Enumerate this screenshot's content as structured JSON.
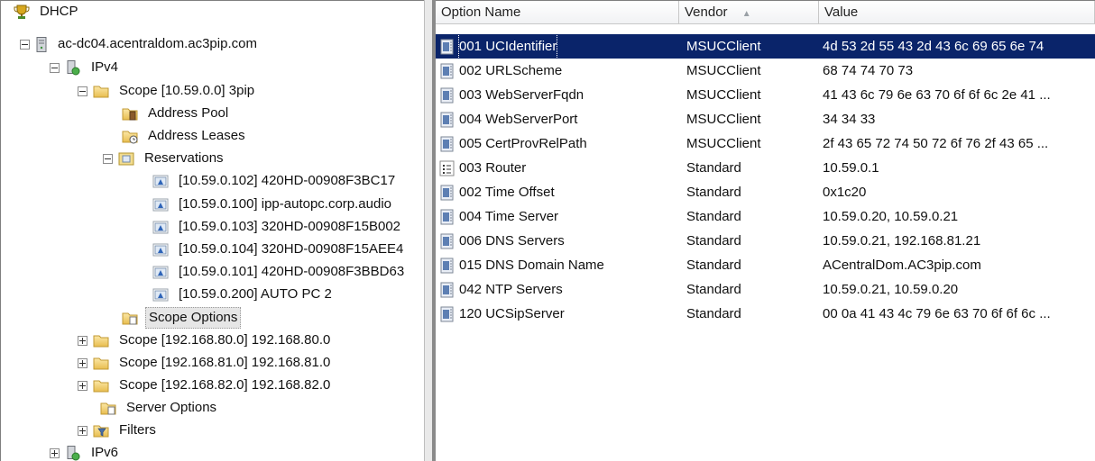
{
  "tree": {
    "root": "DHCP",
    "server": "ac-dc04.acentraldom.ac3pip.com",
    "ipv4": "IPv4",
    "scope_main": "Scope [10.59.0.0] 3pip",
    "address_pool": "Address Pool",
    "address_leases": "Address Leases",
    "reservations": "Reservations",
    "reservation_items": [
      "[10.59.0.102] 420HD-00908F3BC17",
      "[10.59.0.100] ipp-autopc.corp.audio",
      "[10.59.0.103] 320HD-00908F15B002",
      "[10.59.0.104] 320HD-00908F15AEE4",
      "[10.59.0.101] 420HD-00908F3BBD63",
      "[10.59.0.200] AUTO PC 2"
    ],
    "scope_options": "Scope Options",
    "scopes": [
      "Scope [192.168.80.0] 192.168.80.0",
      "Scope [192.168.81.0] 192.168.81.0",
      "Scope [192.168.82.0] 192.168.82.0"
    ],
    "server_options": "Server Options",
    "filters": "Filters",
    "ipv6": "IPv6"
  },
  "list": {
    "columns": {
      "name": "Option Name",
      "vendor": "Vendor",
      "value": "Value"
    },
    "sort_indicator": "▲",
    "rows": [
      {
        "name": "001 UCIdentifier",
        "vendor": "MSUCClient",
        "value": "4d 53 2d 55 43 2d 43 6c 69 65 6e 74",
        "icon": "option-binary-icon",
        "selected": true
      },
      {
        "name": "002 URLScheme",
        "vendor": "MSUCClient",
        "value": "68 74 74 70 73",
        "icon": "option-binary-icon"
      },
      {
        "name": "003 WebServerFqdn",
        "vendor": "MSUCClient",
        "value": "41 43 6c 79 6e 63 70 6f 6f 6c 2e 41 ...",
        "icon": "option-binary-icon"
      },
      {
        "name": "004 WebServerPort",
        "vendor": "MSUCClient",
        "value": "34 34 33",
        "icon": "option-binary-icon"
      },
      {
        "name": "005 CertProvRelPath",
        "vendor": "MSUCClient",
        "value": "2f 43 65 72 74 50 72 6f 76 2f 43 65 ...",
        "icon": "option-binary-icon"
      },
      {
        "name": "003 Router",
        "vendor": "Standard",
        "value": "10.59.0.1",
        "icon": "option-list-icon"
      },
      {
        "name": "002 Time Offset",
        "vendor": "Standard",
        "value": "0x1c20",
        "icon": "option-binary-icon"
      },
      {
        "name": "004 Time Server",
        "vendor": "Standard",
        "value": "10.59.0.20, 10.59.0.21",
        "icon": "option-binary-icon"
      },
      {
        "name": "006 DNS Servers",
        "vendor": "Standard",
        "value": "10.59.0.21, 192.168.81.21",
        "icon": "option-binary-icon"
      },
      {
        "name": "015 DNS Domain Name",
        "vendor": "Standard",
        "value": "ACentralDom.AC3pip.com",
        "icon": "option-binary-icon"
      },
      {
        "name": "042 NTP Servers",
        "vendor": "Standard",
        "value": "10.59.0.21, 10.59.0.20",
        "icon": "option-binary-icon"
      },
      {
        "name": "120 UCSipServer",
        "vendor": "Standard",
        "value": "00 0a 41 43 4c 79 6e 63 70 6f 6f 6c ...",
        "icon": "option-binary-icon"
      }
    ]
  },
  "colors": {
    "selection": "#0a246a",
    "folder": "#f2cf6a",
    "splitter": "#8a8a8a"
  }
}
